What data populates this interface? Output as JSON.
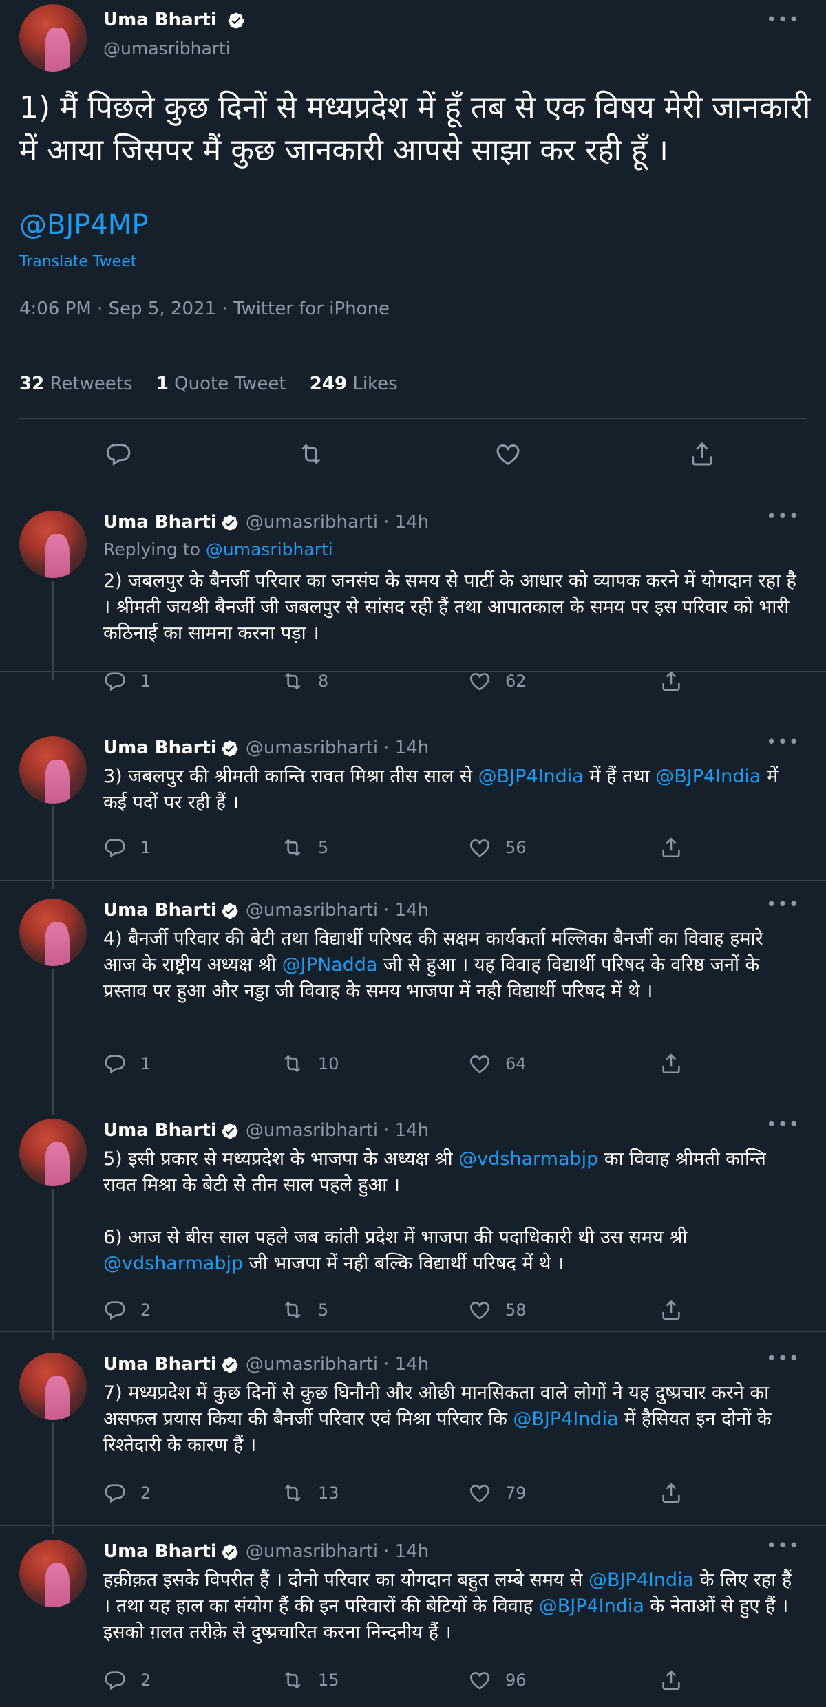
{
  "main": {
    "name": "Uma Bharti",
    "handle": "@umasribharti",
    "text": "1) मैं पिछले कुछ दिनों से मध्यप्रदेश में हूँ तब से एक विषय मेरी जानकारी में आया जिसपर मैं कुछ जानकारी आपसे साझा कर रही हूँ ।",
    "mention": "@BJP4MP",
    "translate": "Translate Tweet",
    "meta": "4:06 PM · Sep 5, 2021 · Twitter for iPhone",
    "retweets_count": "32",
    "retweets_label": "Retweets",
    "quotes_count": "1",
    "quotes_label": "Quote Tweet",
    "likes_count": "249",
    "likes_label": "Likes",
    "more": "•••"
  },
  "replies": [
    {
      "name": "Uma Bharti",
      "handle": "@umasribharti",
      "time": "· 14h",
      "replying_prefix": "Replying to",
      "replying_to": "@umasribharti",
      "body": [
        {
          "t": "2) जबलपुर के बैनर्जी परिवार का जनसंघ के समय से पार्टी के आधार को व्यापक करने में योगदान रहा है । श्रीमती जयश्री बैनर्जी जी जबलपुर से सांसद रही हैं तथा आपातकाल के समय पर इस परिवार को भारी कठिनाई का सामना करना पड़ा ।",
          "link": false
        }
      ],
      "replies": "1",
      "retweets": "8",
      "likes": "62"
    },
    {
      "name": "Uma Bharti",
      "handle": "@umasribharti",
      "time": "· 14h",
      "body": [
        {
          "t": "3) जबलपुर की श्रीमती कान्ति रावत मिश्रा तीस साल से ",
          "link": false
        },
        {
          "t": "@BJP4India",
          "link": true
        },
        {
          "t": " में हैं तथा ",
          "link": false
        },
        {
          "t": "@BJP4India",
          "link": true
        },
        {
          "t": " में कई पदों पर रही हैं ।",
          "link": false
        }
      ],
      "replies": "1",
      "retweets": "5",
      "likes": "56"
    },
    {
      "name": "Uma Bharti",
      "handle": "@umasribharti",
      "time": "· 14h",
      "body": [
        {
          "t": "4) बैनर्जी परिवार की बेटी तथा विद्यार्थी परिषद की सक्षम कार्यकर्ता मल्लिका बैनर्जी का विवाह हमारे आज के राष्ट्रीय अध्यक्ष श्री ",
          "link": false
        },
        {
          "t": "@JPNadda",
          "link": true
        },
        {
          "t": " जी से हुआ । यह विवाह विद्यार्थी परिषद के वरिष्ठ जनों के प्रस्ताव पर हुआ और नड्डा जी विवाह के समय भाजपा में नही विद्यार्थी परिषद में थे ।",
          "link": false
        }
      ],
      "replies": "1",
      "retweets": "10",
      "likes": "64"
    },
    {
      "name": "Uma Bharti",
      "handle": "@umasribharti",
      "time": "· 14h",
      "body": [
        {
          "t": "5) इसी प्रकार से मध्यप्रदेश के भाजपा के अध्यक्ष श्री ",
          "link": false
        },
        {
          "t": "@vdsharmabjp",
          "link": true
        },
        {
          "t": " का विवाह श्रीमती कान्ति रावत मिश्रा के बेटी से तीन साल पहले हुआ ।",
          "link": false
        },
        {
          "br": true
        },
        {
          "t": "6) आज से बीस साल पहले जब कांती प्रदेश में भाजपा की पदाधिकारी थी उस समय श्री ",
          "link": false
        },
        {
          "t": "@vdsharmabjp",
          "link": true
        },
        {
          "t": " जी भाजपा में नही बल्कि विद्यार्थी परिषद में थे ।",
          "link": false
        }
      ],
      "replies": "2",
      "retweets": "5",
      "likes": "58"
    },
    {
      "name": "Uma Bharti",
      "handle": "@umasribharti",
      "time": "· 14h",
      "body": [
        {
          "t": "7) मध्यप्रदेश में कुछ दिनों से कुछ घिनौनी और ओछी मानसिकता वाले लोगों ने यह दुष्प्रचार करने का असफल प्रयास किया की बैनर्जी परिवार एवं मिश्रा परिवार कि ",
          "link": false
        },
        {
          "t": "@BJP4India",
          "link": true
        },
        {
          "t": " में हैसियत इन दोनों के रिश्तेदारी के कारण हैं ।",
          "link": false
        }
      ],
      "replies": "2",
      "retweets": "13",
      "likes": "79"
    },
    {
      "name": "Uma Bharti",
      "handle": "@umasribharti",
      "time": "· 14h",
      "body": [
        {
          "t": "हक़ीक़त इसके विपरीत हैं । दोनो परिवार का योगदान बहुत लम्बे समय से ",
          "link": false
        },
        {
          "t": "@BJP4India",
          "link": true
        },
        {
          "t": " के लिए रहा हैं । तथा यह हाल का संयोग हैं की इन परिवारों की बेटियों के विवाह ",
          "link": false
        },
        {
          "t": "@BJP4India",
          "link": true
        },
        {
          "t": " के नेताओं से हुए हैं । इसको ग़लत तरीक़े से दुष्प्रचारित करना निन्दनीय हैं ।",
          "link": false
        }
      ],
      "replies": "2",
      "retweets": "15",
      "likes": "96"
    }
  ],
  "colors": {
    "background": "#15202b",
    "accent": "#1d9bf0",
    "muted": "#8b98a5",
    "divider": "#38444d"
  },
  "icons": [
    "verified-badge-icon",
    "more-icon",
    "reply-icon",
    "retweet-icon",
    "like-icon",
    "share-icon"
  ]
}
